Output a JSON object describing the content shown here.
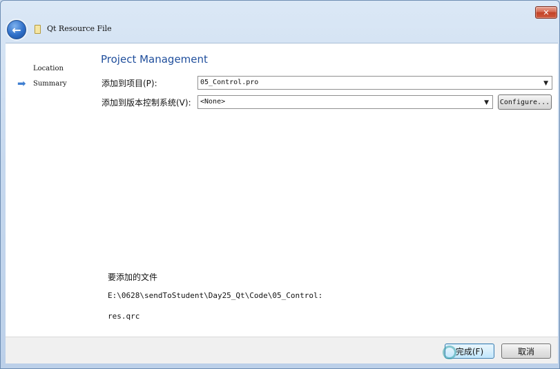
{
  "window": {
    "title": "Qt Resource File",
    "close_glyph": "✕",
    "back_glyph": "←",
    "icons": {
      "back": "back-arrow-icon",
      "close": "close-icon",
      "title": "file-icon"
    }
  },
  "nav": {
    "items": [
      {
        "label": "Location",
        "active": false
      },
      {
        "label": "Summary",
        "active": true
      }
    ],
    "active_marker_glyph": "➡",
    "active_marker_icon": "arrow-right-icon"
  },
  "page": {
    "title": "Project Management",
    "add_to_project_label": "添加到项目(P):",
    "add_to_project_value": "05_Control.pro",
    "add_to_vcs_label": "添加到版本控制系统(V):",
    "add_to_vcs_value": "<None>",
    "configure_label": "Configure...",
    "combo_arrow_glyph": "▼"
  },
  "files": {
    "heading": "要添加的文件",
    "path": "E:\\0628\\sendToStudent\\Day25_Qt\\Code\\05_Control:",
    "items": [
      "res.qrc"
    ]
  },
  "footer": {
    "finish_label": "完成(F)",
    "cancel_label": "取消"
  },
  "colors": {
    "title_accent": "#1f4e9c",
    "nav_arrow": "#3f7fd1",
    "frame": "#c6d8ee"
  }
}
